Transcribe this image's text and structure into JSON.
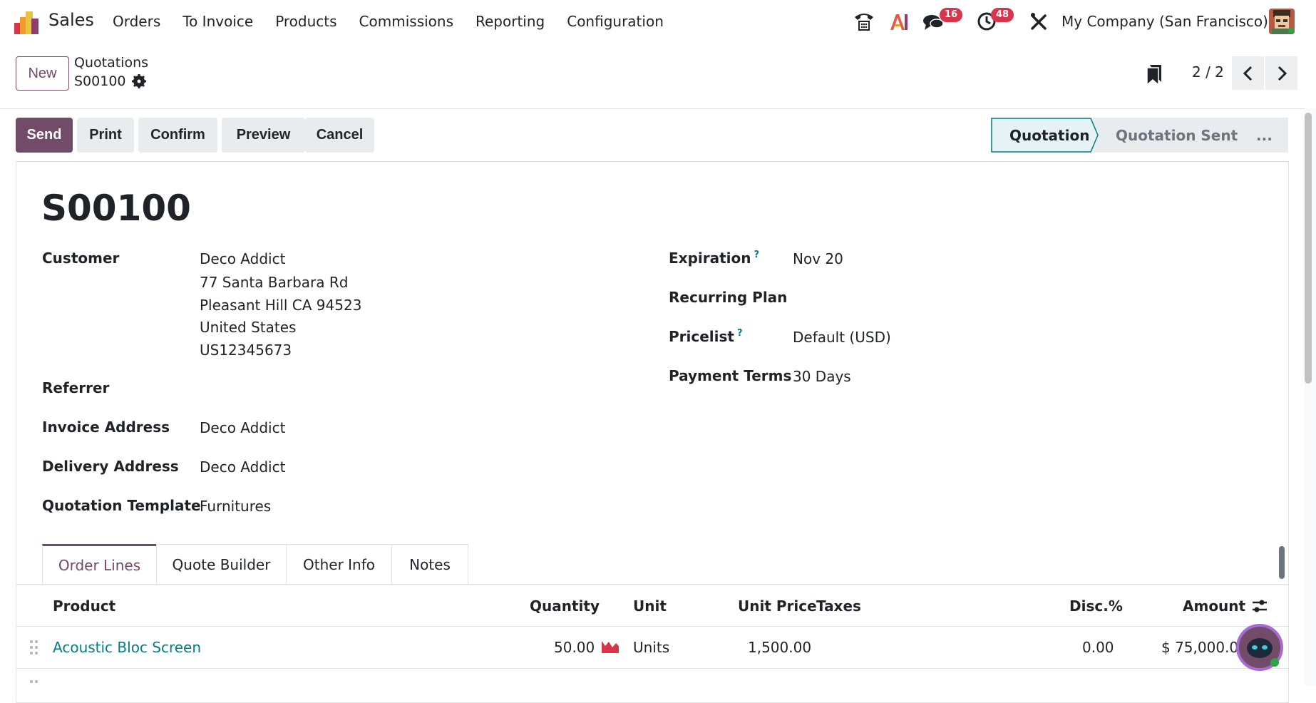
{
  "nav": {
    "app_name": "Sales",
    "menu": [
      "Orders",
      "To Invoice",
      "Products",
      "Commissions",
      "Reporting",
      "Configuration"
    ],
    "messages_badge": "16",
    "activities_badge": "48",
    "company": "My Company (San Francisco)"
  },
  "control": {
    "new_label": "New",
    "breadcrumb_parent": "Quotations",
    "breadcrumb_current": "S00100",
    "pager": "2 / 2"
  },
  "actions": {
    "send": "Send",
    "print": "Print",
    "confirm": "Confirm",
    "preview": "Preview",
    "cancel": "Cancel"
  },
  "statusbar": {
    "stages": [
      "Quotation",
      "Quotation Sent",
      "..."
    ],
    "active": "Quotation"
  },
  "form": {
    "title": "S00100",
    "customer_label": "Customer",
    "customer_lines": [
      "Deco Addict",
      "77 Santa Barbara Rd",
      "Pleasant Hill CA 94523",
      "United States",
      "US12345673"
    ],
    "referrer_label": "Referrer",
    "invoice_address_label": "Invoice Address",
    "invoice_address": "Deco Addict",
    "delivery_address_label": "Delivery Address",
    "delivery_address": "Deco Addict",
    "quotation_template_label": "Quotation Template",
    "quotation_template": "Furnitures",
    "expiration_label": "Expiration",
    "expiration": "Nov 20",
    "recurring_plan_label": "Recurring Plan",
    "pricelist_label": "Pricelist",
    "pricelist": "Default (USD)",
    "payment_terms_label": "Payment Terms",
    "payment_terms": "30 Days",
    "help_mark": "?"
  },
  "tabs": [
    "Order Lines",
    "Quote Builder",
    "Other Info",
    "Notes"
  ],
  "table": {
    "headers": {
      "product": "Product",
      "quantity": "Quantity",
      "unit": "Unit",
      "unit_price": "Unit Price",
      "taxes": "Taxes",
      "discount": "Disc.%",
      "amount": "Amount"
    },
    "rows": [
      {
        "product": "Acoustic Bloc Screen",
        "quantity": "50.00",
        "unit": "Units",
        "unit_price": "1,500.00",
        "taxes": "",
        "discount": "0.00",
        "amount": "$ 75,000.00"
      }
    ]
  },
  "colors": {
    "brand": "#714b67",
    "link": "#017e84",
    "badge": "#d9344a"
  }
}
